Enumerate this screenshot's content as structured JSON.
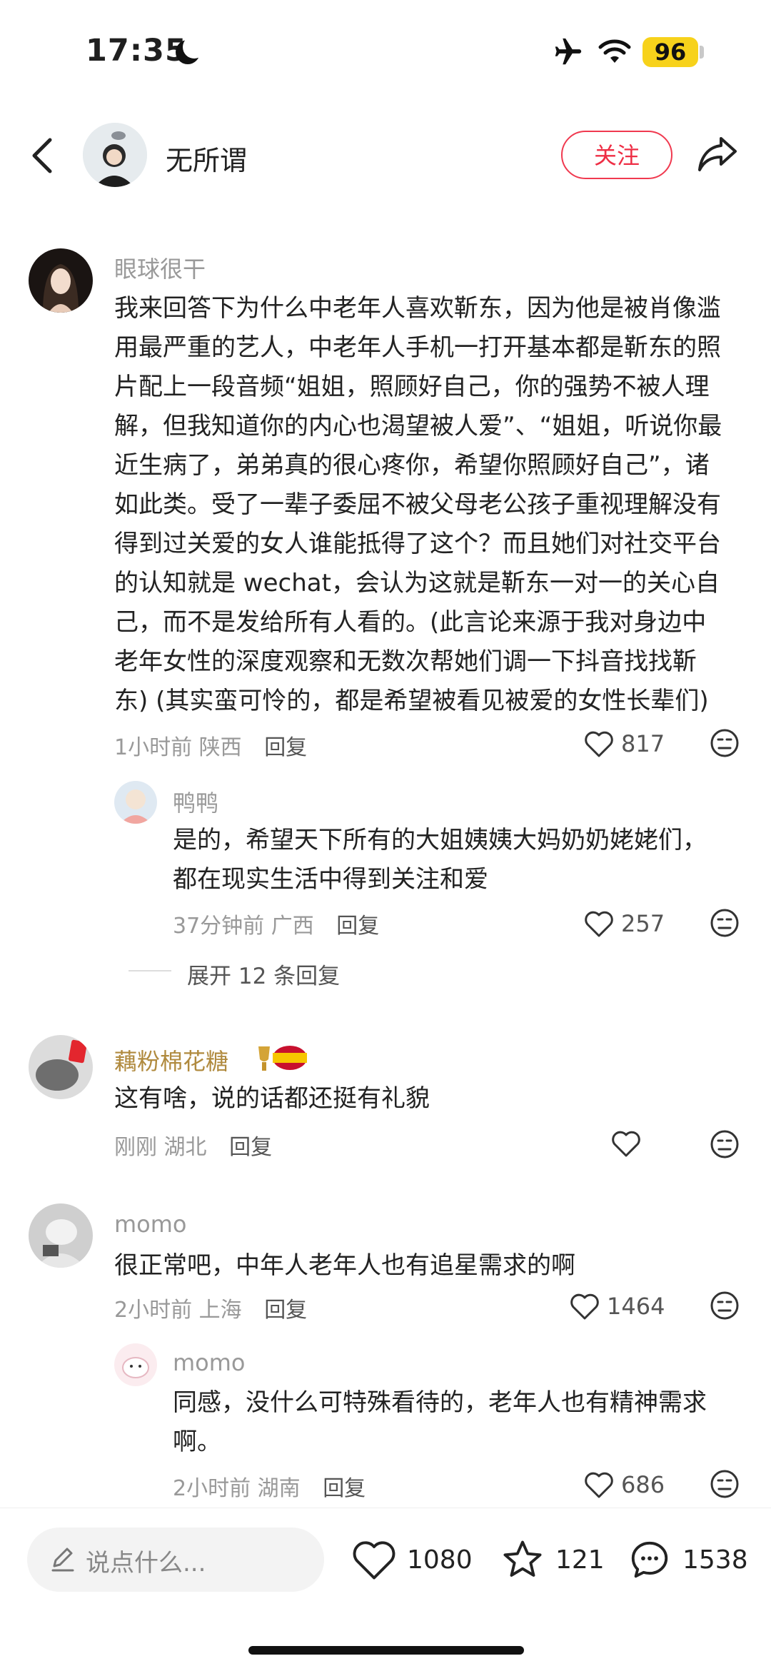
{
  "status_bar": {
    "time": "17:35",
    "battery": "96"
  },
  "header": {
    "author_name": "无所谓",
    "follow_label": "关注"
  },
  "comments": [
    {
      "username": "眼球很干",
      "text_lines": [
        "我来回答下为什么中老年人喜欢靳东，因为他是被肖像滥",
        "用最严重的艺人，中老年人手机一打开基本都是靳东的照",
        "片配上一段音频“姐姐，照顾好自己，你的强势不被人理",
        "解，但我知道你的内心也渴望被人爱”、“姐姐，听说你最",
        "近生病了，弟弟真的很心疼你，希望你照顾好自己”，诸",
        "如此类。受了一辈子委屈不被父母老公孩子重视理解没有",
        "得到过关爱的女人谁能抵得了这个？而且她们对社交平台",
        "的认知就是 wechat，会认为这就是靳东一对一的关心自",
        "己，而不是发给所有人看的。(此言论来源于我对身边中",
        "老年女性的深度观察和无数次帮她们调一下抖音找找靳",
        "东) (其实蛮可怜的，都是希望被看见被爱的女性长辈们)"
      ],
      "time": "1小时前",
      "location": "陕西",
      "reply_label": "回复",
      "likes": "817",
      "replies": [
        {
          "username": "鸭鸭",
          "text_lines": [
            "是的，希望天下所有的大姐姨姨大妈奶奶姥姥们，",
            "都在现实生活中得到关注和爱"
          ],
          "time": "37分钟前",
          "location": "广西",
          "reply_label": "回复",
          "likes": "257"
        }
      ],
      "expand_label": "展开 12 条回复"
    },
    {
      "username": "藕粉棉花糖",
      "text_lines": [
        "这有啥，说的话都还挺有礼貌"
      ],
      "time": "刚刚",
      "location": "湖北",
      "reply_label": "回复",
      "likes": ""
    },
    {
      "username": "momo",
      "text_lines": [
        "很正常吧，中年人老年人也有追星需求的啊"
      ],
      "time": "2小时前",
      "location": "上海",
      "reply_label": "回复",
      "likes": "1464",
      "replies": [
        {
          "username": "momo",
          "text_lines": [
            "同感，没什么可特殊看待的，老年人也有精神需求",
            "啊。"
          ],
          "time": "2小时前",
          "location": "湖南",
          "reply_label": "回复",
          "likes": "686"
        }
      ]
    }
  ],
  "bottom_bar": {
    "input_placeholder": "说点什么...",
    "like_count": "1080",
    "favorite_count": "121",
    "comment_count": "1538"
  },
  "colors": {
    "accent": "#ee2e45",
    "battery": "#f7d21b",
    "gold_name": "#b08a3e"
  },
  "icons": [
    "airplane-icon",
    "wifi-icon",
    "back-icon",
    "share-icon",
    "heart-icon",
    "dislike-icon",
    "star-icon",
    "chat-icon",
    "pen-icon"
  ]
}
